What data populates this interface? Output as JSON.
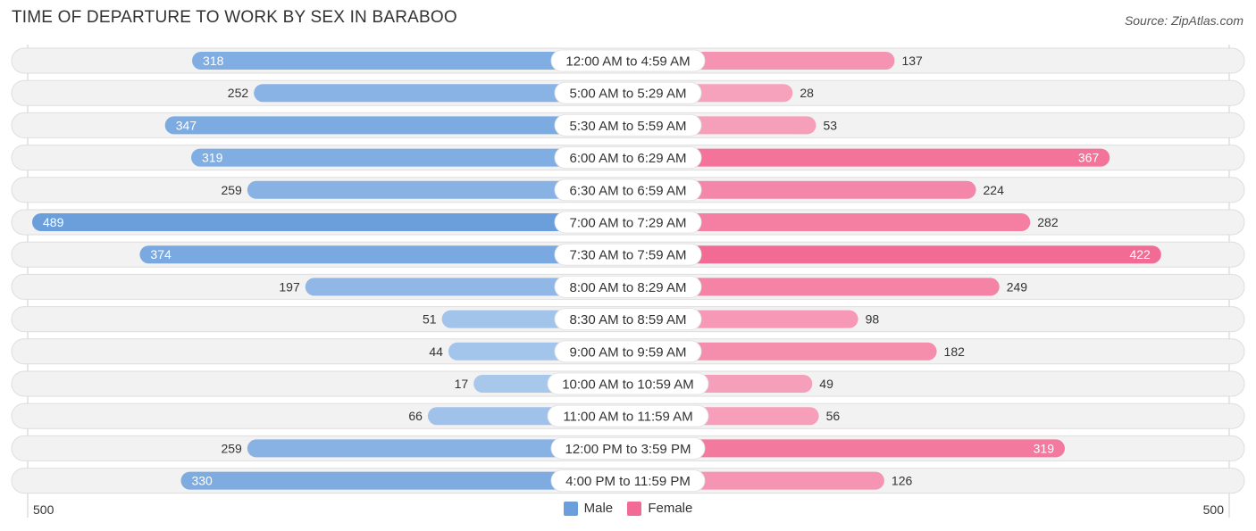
{
  "title": "TIME OF DEPARTURE TO WORK BY SEX IN BARABOO",
  "source": "Source: ZipAtlas.com",
  "colors": {
    "male": "#6a9fdc",
    "male_light": "#a9c8ec",
    "female": "#f26b94",
    "female_light": "#f7a6c0",
    "track": "#f2f2f2"
  },
  "chart_data": {
    "type": "bar",
    "orientation": "horizontal-diverging",
    "title": "TIME OF DEPARTURE TO WORK BY SEX IN BARABOO",
    "categories": [
      "12:00 AM to 4:59 AM",
      "5:00 AM to 5:29 AM",
      "5:30 AM to 5:59 AM",
      "6:00 AM to 6:29 AM",
      "6:30 AM to 6:59 AM",
      "7:00 AM to 7:29 AM",
      "7:30 AM to 7:59 AM",
      "8:00 AM to 8:29 AM",
      "8:30 AM to 8:59 AM",
      "9:00 AM to 9:59 AM",
      "10:00 AM to 10:59 AM",
      "11:00 AM to 11:59 AM",
      "12:00 PM to 3:59 PM",
      "4:00 PM to 11:59 PM"
    ],
    "series": [
      {
        "name": "Male",
        "values": [
          318,
          252,
          347,
          319,
          259,
          489,
          374,
          197,
          51,
          44,
          17,
          66,
          259,
          330
        ]
      },
      {
        "name": "Female",
        "values": [
          137,
          28,
          53,
          367,
          224,
          282,
          422,
          249,
          98,
          182,
          49,
          56,
          319,
          126
        ]
      }
    ],
    "axis": {
      "left_label": "500",
      "right_label": "500",
      "range": [
        0,
        500
      ]
    },
    "legend": {
      "position": "bottom-center",
      "entries": [
        "Male",
        "Female"
      ]
    }
  }
}
